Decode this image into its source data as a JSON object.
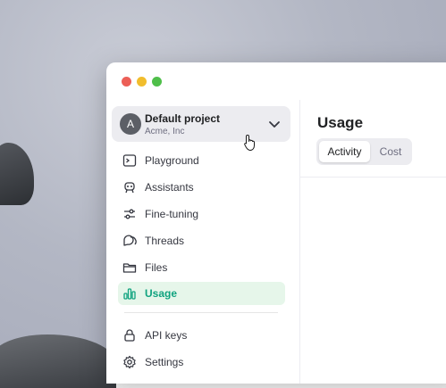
{
  "window": {
    "controls": [
      "close",
      "minimize",
      "maximize"
    ]
  },
  "project": {
    "avatar_letter": "A",
    "name": "Default project",
    "org": "Acme, Inc"
  },
  "nav": {
    "items": [
      {
        "label": "Playground",
        "icon": "terminal-icon"
      },
      {
        "label": "Assistants",
        "icon": "robot-icon"
      },
      {
        "label": "Fine-tuning",
        "icon": "sliders-icon"
      },
      {
        "label": "Threads",
        "icon": "chat-bubbles-icon"
      },
      {
        "label": "Files",
        "icon": "folder-icon"
      },
      {
        "label": "Usage",
        "icon": "bar-chart-icon",
        "active": true
      },
      {
        "label": "API keys",
        "icon": "lock-icon"
      },
      {
        "label": "Settings",
        "icon": "gear-icon"
      }
    ]
  },
  "main": {
    "title": "Usage",
    "tabs": [
      {
        "label": "Activity",
        "selected": true
      },
      {
        "label": "Cost",
        "selected": false
      }
    ]
  },
  "colors": {
    "accent": "#10a37f",
    "active_bg": "#e6f6ea"
  }
}
